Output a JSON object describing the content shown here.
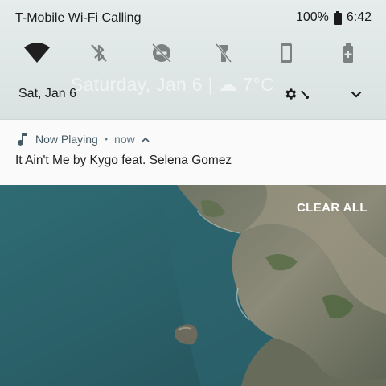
{
  "status_bar": {
    "carrier": "T-Mobile Wi-Fi Calling",
    "battery_percent": "100%",
    "time": "6:42"
  },
  "quick_settings": {
    "tiles": [
      {
        "icon": "wifi-icon",
        "state": "on"
      },
      {
        "icon": "bluetooth-off-icon",
        "state": "off"
      },
      {
        "icon": "do-not-disturb-off-icon",
        "state": "off"
      },
      {
        "icon": "flashlight-off-icon",
        "state": "off"
      },
      {
        "icon": "auto-rotate-icon",
        "state": "off"
      },
      {
        "icon": "battery-saver-icon",
        "state": "off"
      }
    ],
    "date": "Sat, Jan 6",
    "background_text": "Saturday, Jan 6 | ☁ 7°C",
    "settings_icon": "gear-icon",
    "expand_icon": "chevron-down-icon"
  },
  "notification": {
    "app_icon": "music-note-icon",
    "app_name": "Now Playing",
    "separator": "•",
    "time": "now",
    "expand_icon": "chevron-up-icon",
    "text": "It Ain't Me by Kygo feat. Selena Gomez"
  },
  "wallpaper": {
    "clear_all_label": "CLEAR ALL"
  },
  "colors": {
    "shade_bg": "#e3eae9",
    "notification_bg": "#fafafa",
    "accent_header": "#455a64",
    "sea": "#2a5c66",
    "rock": "#8d8a7a"
  }
}
